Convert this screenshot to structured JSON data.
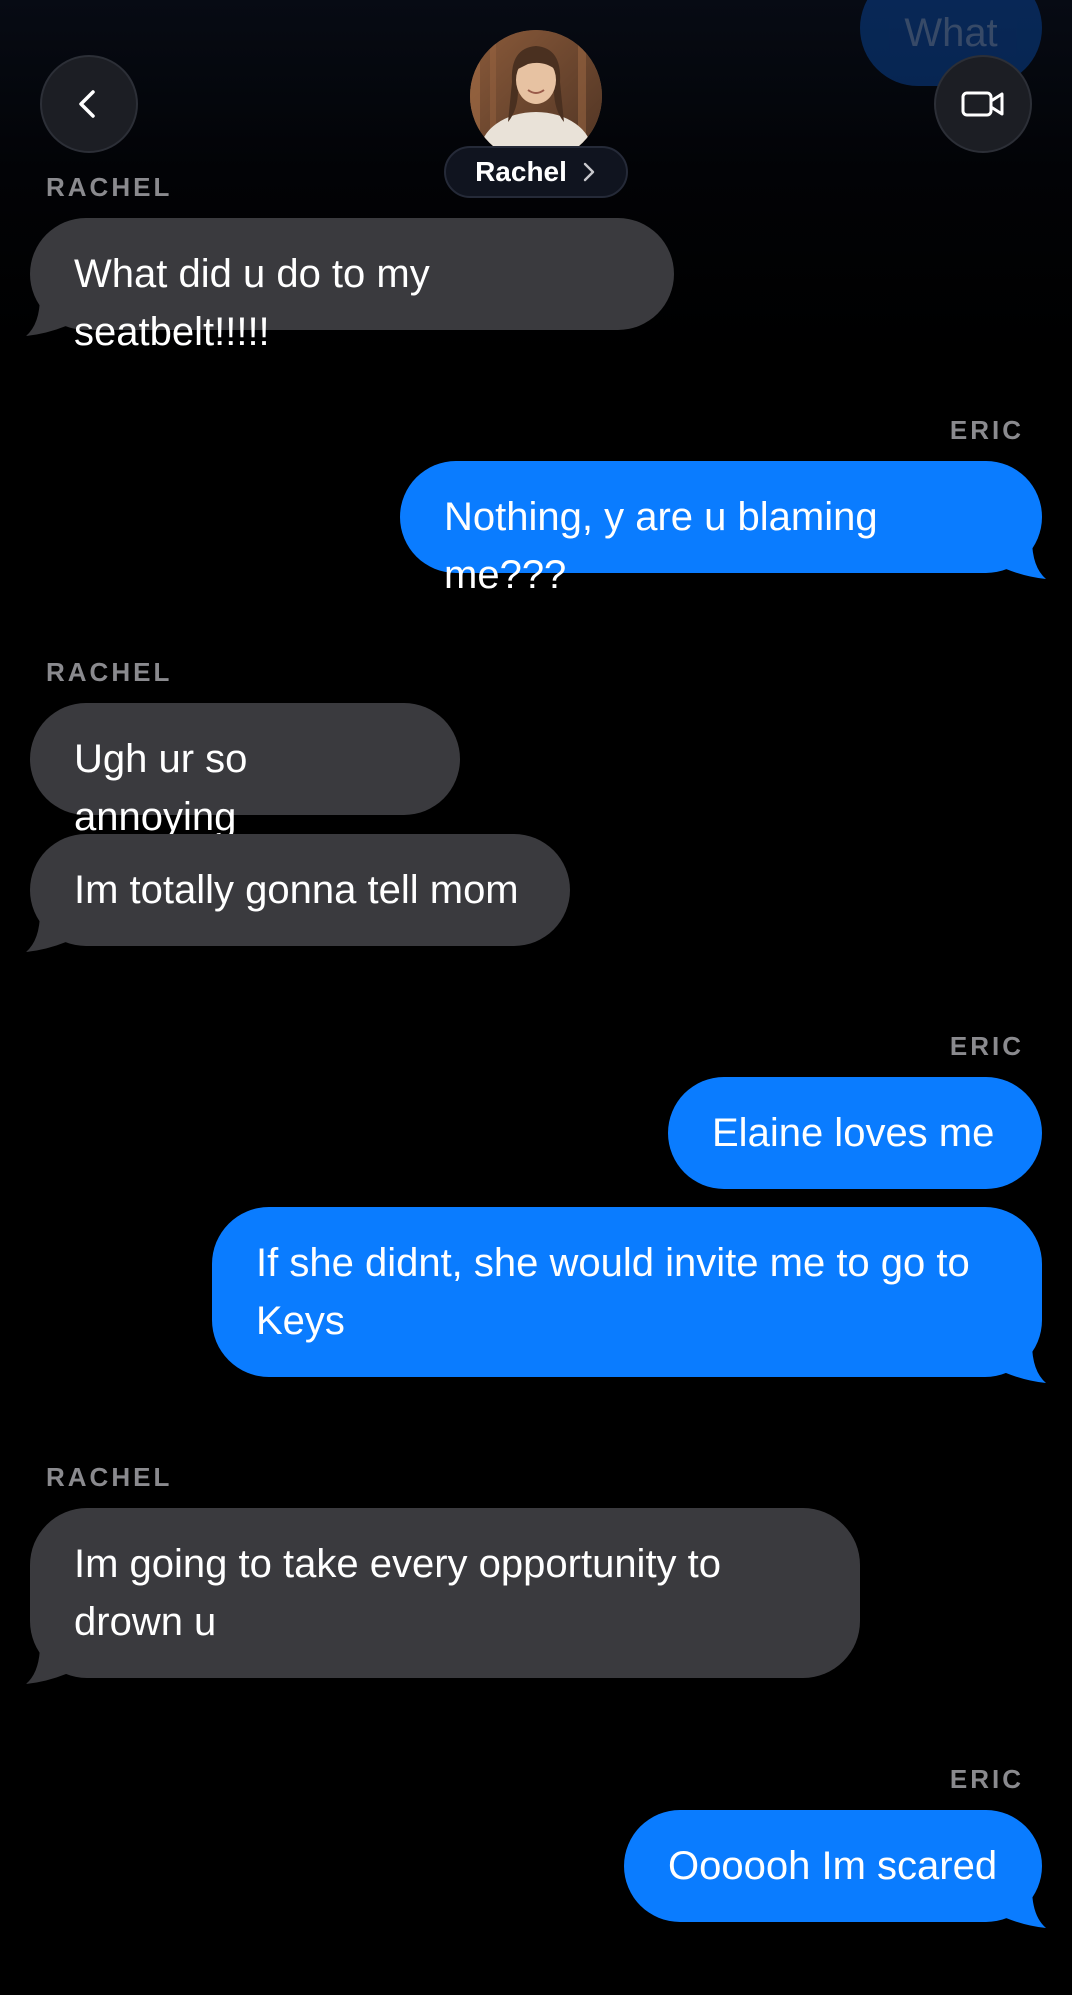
{
  "header": {
    "contact_name": "Rachel",
    "previous_message": "What"
  },
  "messages": [
    {
      "sender": "RACHEL",
      "side": "in",
      "texts": [
        "What did u do to my seatbelt!!!!!"
      ]
    },
    {
      "sender": "ERIC",
      "side": "out",
      "texts": [
        "Nothing, y are u blaming me???"
      ]
    },
    {
      "sender": "RACHEL",
      "side": "in",
      "texts": [
        "Ugh ur so annoying",
        "Im totally gonna tell mom"
      ]
    },
    {
      "sender": "ERIC",
      "side": "out",
      "texts": [
        "Elaine loves me",
        "If she didnt, she would invite me to go to Keys"
      ]
    },
    {
      "sender": "RACHEL",
      "side": "in",
      "texts": [
        "Im going to take every opportunity to drown u"
      ]
    },
    {
      "sender": "ERIC",
      "side": "out",
      "texts": [
        "Oooooh Im scared"
      ]
    }
  ],
  "colors": {
    "incoming_bubble": "#3a3a3e",
    "outgoing_bubble": "#0a7cff",
    "sender_label": "#8a8a8e",
    "background": "#000000"
  },
  "icons": {
    "back": "chevron-left-icon",
    "video": "video-camera-icon",
    "contact_more": "chevron-right-icon"
  }
}
